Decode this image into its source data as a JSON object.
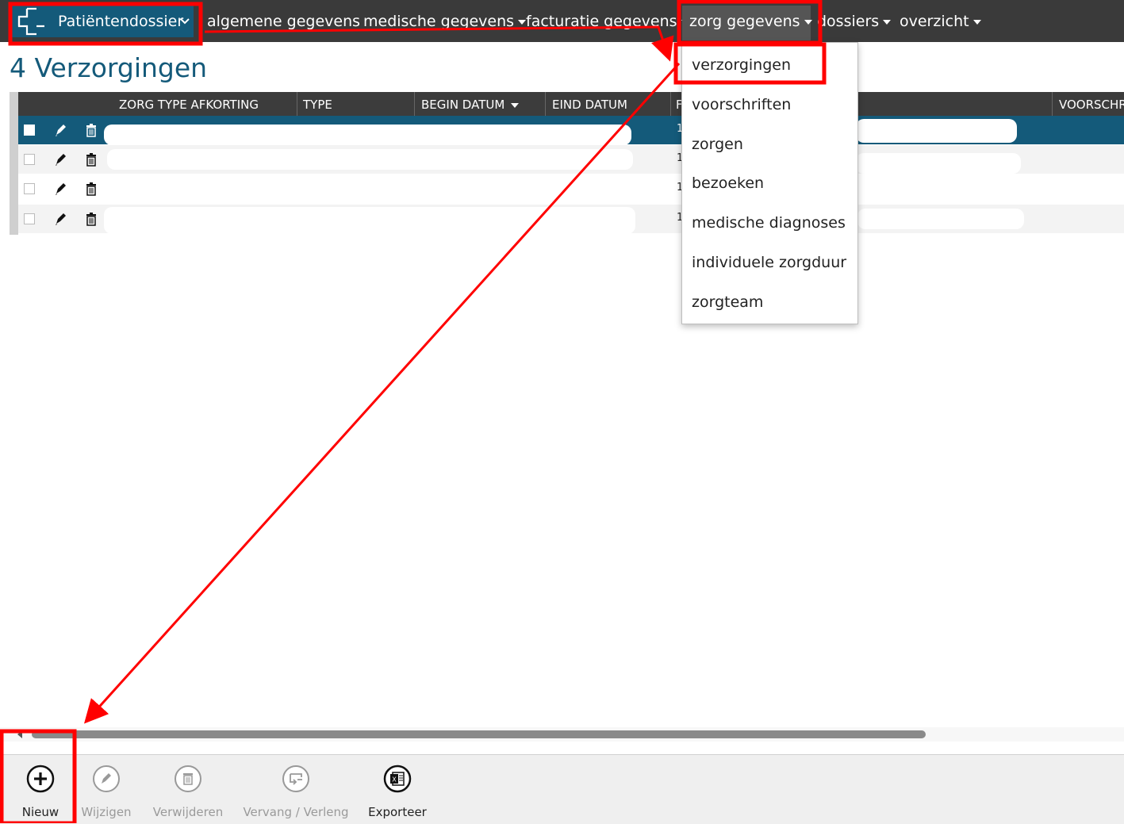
{
  "nav": {
    "brand": "Patiëntendossier",
    "items": [
      {
        "label": "algemene gegevens"
      },
      {
        "label": "medische gegevens"
      },
      {
        "label": "facturatie gegevens"
      },
      {
        "label": "zorg gegevens"
      },
      {
        "label": "dossiers"
      },
      {
        "label": "overzicht"
      }
    ]
  },
  "page": {
    "title": "4 Verzorgingen"
  },
  "grid": {
    "columns": [
      "ZORG TYPE AFKORTING",
      "TYPE",
      "BEGIN DATUM",
      "EIND DATUM",
      "F",
      "VOORSCHR"
    ],
    "sorted_column": "BEGIN DATUM",
    "rows": [
      {
        "selected": true,
        "num": "1"
      },
      {
        "selected": false,
        "num": "1"
      },
      {
        "selected": false,
        "num": "1"
      },
      {
        "selected": false,
        "num": "1"
      }
    ]
  },
  "dropdown": {
    "items": [
      "verzorgingen",
      "voorschriften",
      "zorgen",
      "bezoeken",
      "medische diagnoses",
      "individuele zorgduur",
      "zorgteam"
    ],
    "highlighted": "verzorgingen"
  },
  "toolbar": {
    "buttons": [
      {
        "label": "Nieuw",
        "icon": "plus-circle-icon",
        "enabled": true
      },
      {
        "label": "Wijzigen",
        "icon": "pencil-circle-icon",
        "enabled": false
      },
      {
        "label": "Verwijderen",
        "icon": "trash-circle-icon",
        "enabled": false
      },
      {
        "label": "Vervang / Verleng",
        "icon": "replace-circle-icon",
        "enabled": false
      },
      {
        "label": "Exporteer",
        "icon": "excel-icon",
        "enabled": true
      }
    ]
  },
  "annotations": {
    "color": "#ff0000"
  }
}
